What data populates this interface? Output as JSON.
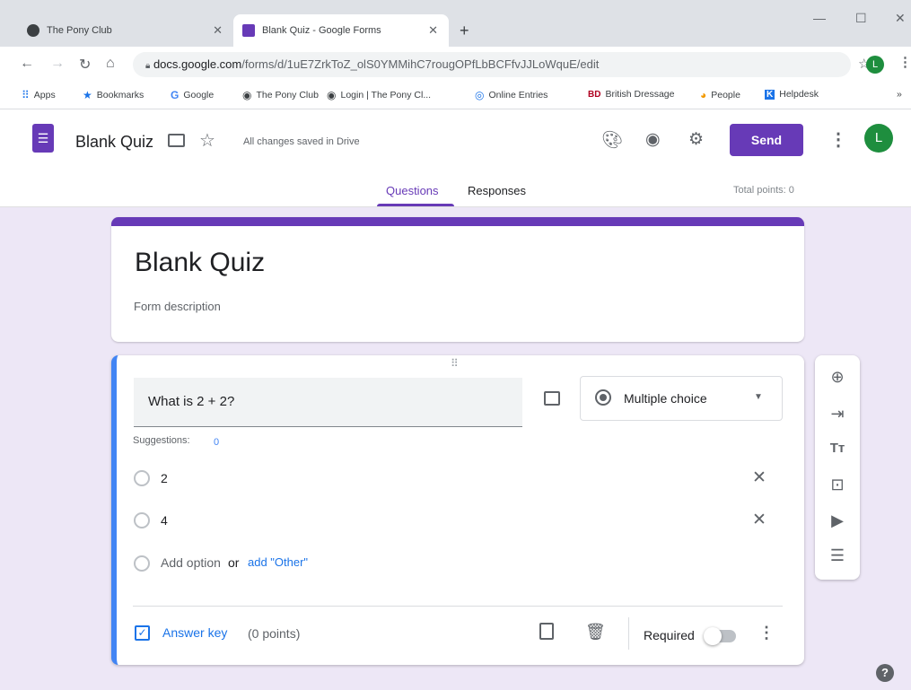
{
  "browser": {
    "tabs": [
      {
        "title": "The Pony Club",
        "icon": "pony-club-favicon"
      },
      {
        "title": "Blank Quiz - Google Forms",
        "icon": "google-forms-favicon"
      }
    ],
    "new_tab": "+",
    "url_host": "docs.google.com",
    "url_path": "/forms/d/1uE7ZrkToZ_olS0YMMihC7rougOPfLbBCFfvJJLoWquE/edit",
    "profile_initial": "L",
    "bookmarks": [
      {
        "label": "Apps",
        "icon": "apps-grid-icon"
      },
      {
        "label": "Bookmarks",
        "icon": "star-icon"
      },
      {
        "label": "Google",
        "icon": "google-g-icon"
      },
      {
        "label": "The Pony Club",
        "icon": "pony-club-icon"
      },
      {
        "label": "Login | The Pony Cl...",
        "icon": "pony-club-icon"
      },
      {
        "label": "Online Entries",
        "icon": "globe-icon"
      },
      {
        "label": "British Dressage",
        "icon": "british-dressage-icon"
      },
      {
        "label": "People",
        "icon": "people-icon"
      },
      {
        "label": "Helpdesk",
        "icon": "helpdesk-icon"
      }
    ],
    "overflow": "»"
  },
  "form_header": {
    "title": "Blank Quiz",
    "save_status": "All changes saved in Drive",
    "send_label": "Send",
    "avatar_initial": "L",
    "tabs": [
      {
        "label": "Questions"
      },
      {
        "label": "Responses"
      }
    ],
    "total_points": "Total points: 0"
  },
  "title_card": {
    "title": "Blank Quiz",
    "description": "Form description"
  },
  "question": {
    "text": "What is 2 + 2?",
    "type": "Multiple choice",
    "suggestions_label": "Suggestions:",
    "suggestions_count": "0",
    "options": [
      "2",
      "4"
    ],
    "add_option": "Add option",
    "or": "or",
    "add_other": "add \"Other\"",
    "answer_key": "Answer key",
    "points": "(0 points)",
    "required_label": "Required",
    "required": false
  },
  "colors": {
    "accent": "#673ab7",
    "question_border": "#4285f4",
    "canvas": "#ede7f6",
    "link": "#1a73e8"
  }
}
